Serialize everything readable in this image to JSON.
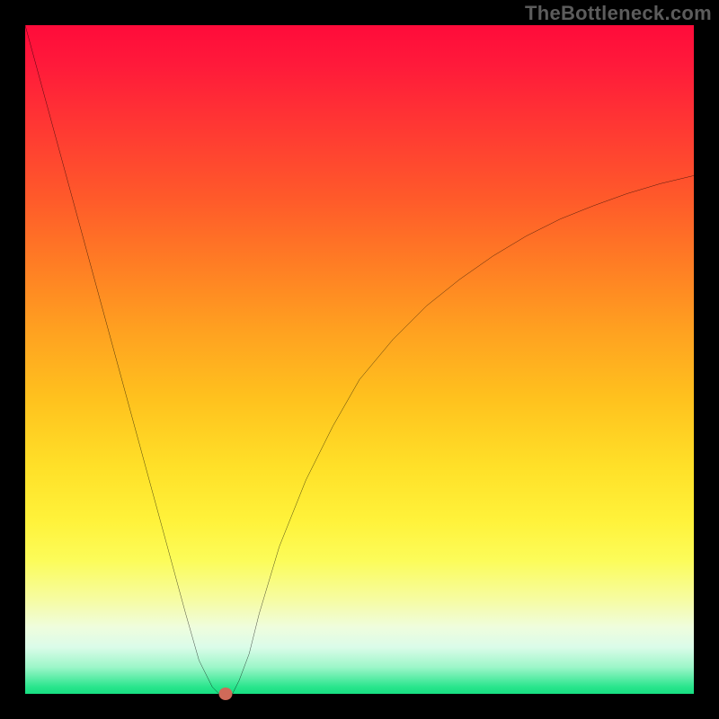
{
  "watermark": "TheBottleneck.com",
  "chart_data": {
    "type": "line",
    "title": "",
    "xlabel": "",
    "ylabel": "",
    "xlim": [
      0,
      100
    ],
    "ylim": [
      0,
      100
    ],
    "grid": false,
    "legend": false,
    "colors": {
      "gradient_top": "#ff0b3a",
      "gradient_bottom": "#17df82",
      "curve": "#000000",
      "marker": "#cf6a59",
      "frame": "#000000"
    },
    "series": [
      {
        "name": "bottleneck-curve",
        "x": [
          0,
          3,
          6,
          9,
          12,
          15,
          18,
          21,
          24,
          26,
          28,
          29,
          30,
          31,
          32,
          33.5,
          35,
          38,
          42,
          46,
          50,
          55,
          60,
          65,
          70,
          75,
          80,
          85,
          90,
          95,
          100
        ],
        "values": [
          100,
          89,
          78,
          67,
          56,
          45,
          34,
          23,
          12,
          5,
          1,
          0,
          0,
          0,
          2,
          6,
          12,
          22,
          32,
          40,
          47,
          53,
          58,
          62,
          65.5,
          68.5,
          71,
          73,
          74.8,
          76.3,
          77.5
        ]
      }
    ],
    "marker": {
      "x": 30,
      "y": 0
    }
  }
}
